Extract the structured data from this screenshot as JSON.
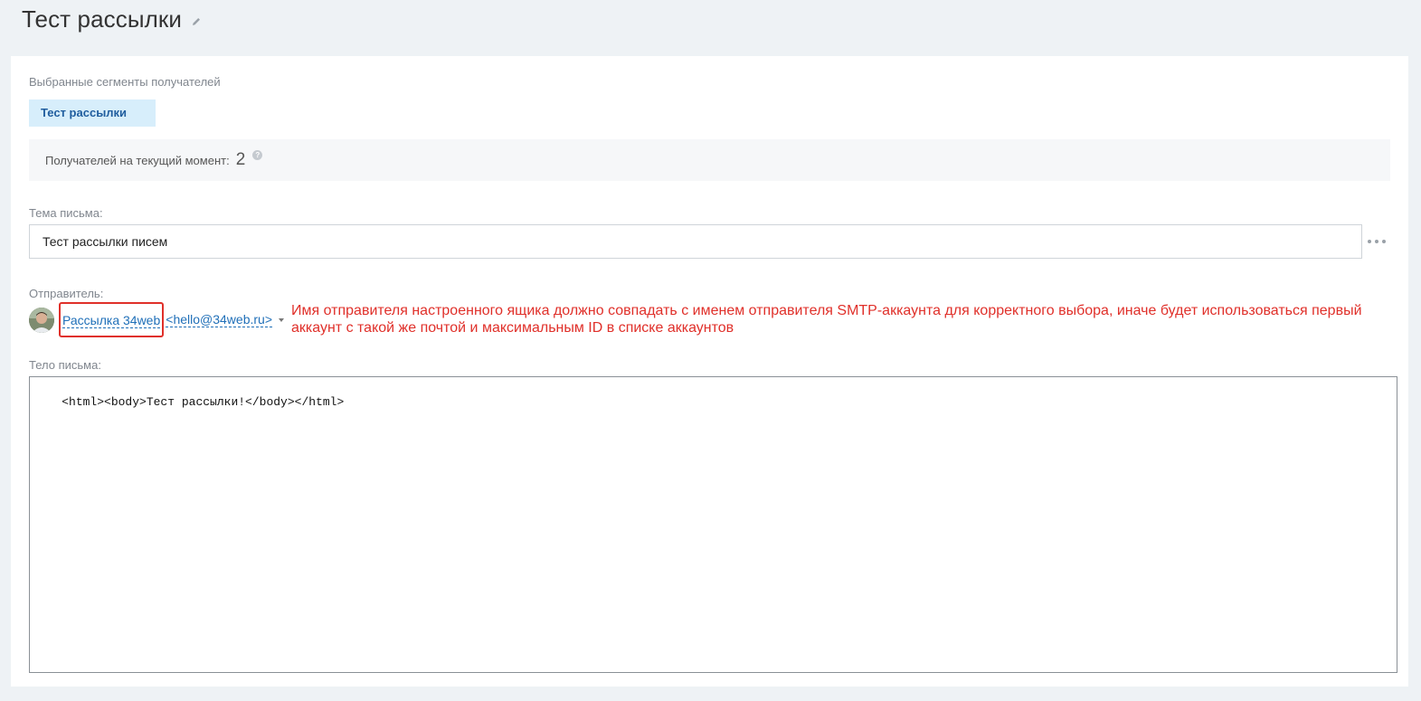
{
  "header": {
    "title": "Тест рассылки",
    "edit_icon": "pencil-icon"
  },
  "segments": {
    "label": "Выбранные сегменты получателей",
    "items": [
      "Тест рассылки"
    ]
  },
  "recipients": {
    "label": "Получателей на текущий момент:",
    "count": "2",
    "help_icon": "?"
  },
  "subject": {
    "label": "Тема письма:",
    "value": "Тест рассылки писем",
    "more_icon": "ellipsis-icon"
  },
  "sender": {
    "label": "Отправитель:",
    "name": "Рассылка 34web",
    "email": "<hello@34web.ru>",
    "highlight_color": "#e0302a"
  },
  "annotation": {
    "text": "Имя отправителя настроенного ящика должно совпадать с именем отправителя SMTP-аккаунта для корректного выбора, иначе будет использоваться первый аккаунт с такой же почтой и максимальным ID в списке аккаунтов",
    "color": "#e0302a"
  },
  "body": {
    "label": "Тело письма:",
    "value": "<html><body>Тест рассылки!</body></html>"
  },
  "colors": {
    "background": "#eef2f5",
    "link": "#1f6fb8",
    "chip_bg": "#d7eefb"
  }
}
